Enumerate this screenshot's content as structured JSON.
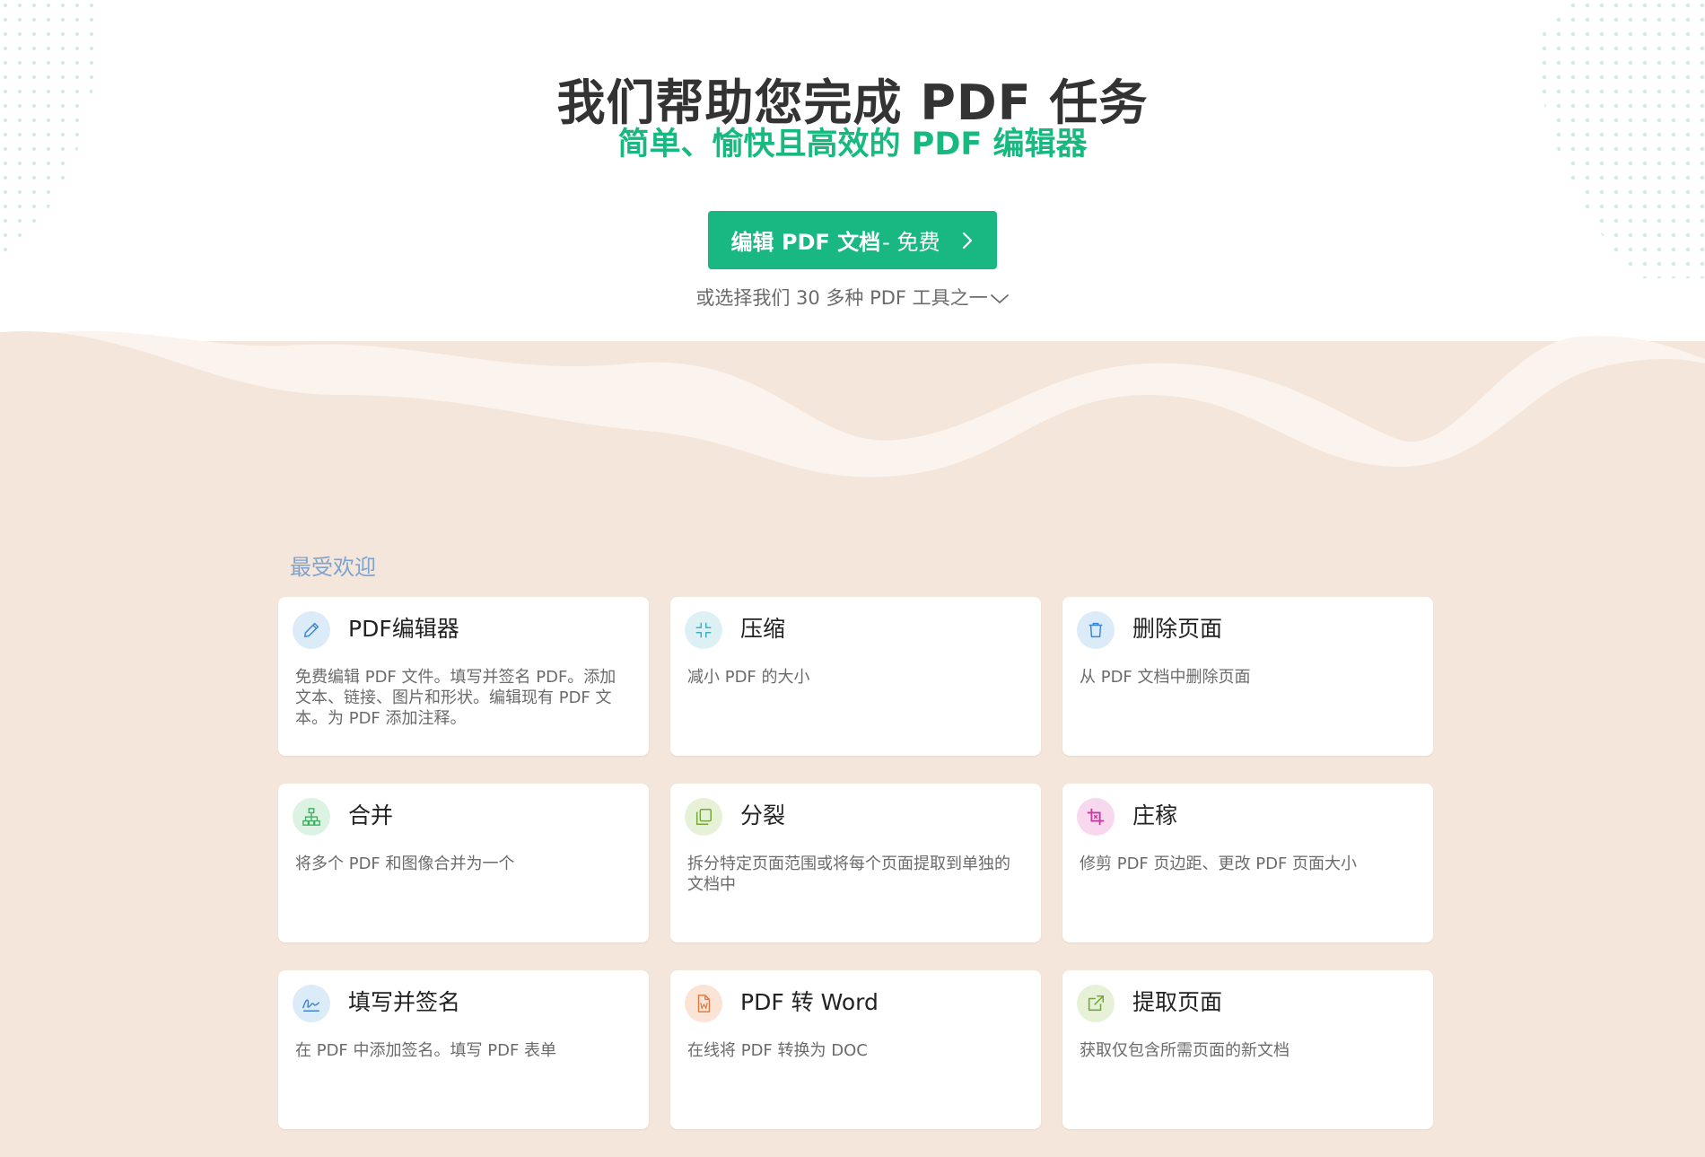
{
  "hero": {
    "title": "我们帮助您完成 PDF 任务",
    "subtitle": "简单、愉快且高效的 PDF 编辑器",
    "cta_main": "编辑 PDF 文档",
    "cta_free": "- 免费",
    "or_choose": "或选择我们 30 多种 PDF 工具之一"
  },
  "section": {
    "label": "最受欢迎"
  },
  "tools": [
    {
      "title": "PDF编辑器",
      "desc": "免费编辑 PDF 文件。填写并签名 PDF。添加文本、链接、图片和形状。编辑现有 PDF 文本。为 PDF 添加注释。",
      "icon": "pencil-icon",
      "icon_bg": "#dcebf8",
      "icon_color": "#3a86d4"
    },
    {
      "title": "压缩",
      "desc": "减小 PDF 的大小",
      "icon": "compress-icon",
      "icon_bg": "#ddf1f5",
      "icon_color": "#3ab0c8"
    },
    {
      "title": "删除页面",
      "desc": "从 PDF 文档中删除页面",
      "icon": "trash-icon",
      "icon_bg": "#dcebf8",
      "icon_color": "#3a86d4"
    },
    {
      "title": "合并",
      "desc": "将多个 PDF 和图像合并为一个",
      "icon": "sitemap-icon",
      "icon_bg": "#dcf3e3",
      "icon_color": "#3cae5f"
    },
    {
      "title": "分裂",
      "desc": "拆分特定页面范围或将每个页面提取到单独的文档中",
      "icon": "copy-icon",
      "icon_bg": "#e6f1d8",
      "icon_color": "#74a83a"
    },
    {
      "title": "庄稼",
      "desc": "修剪 PDF 页边距、更改 PDF 页面大小",
      "icon": "crop-icon",
      "icon_bg": "#f8d8ee",
      "icon_color": "#c83aa0"
    },
    {
      "title": "填写并签名",
      "desc": "在 PDF 中添加签名。填写 PDF 表单",
      "icon": "signature-icon",
      "icon_bg": "#dcebf8",
      "icon_color": "#3a86d4"
    },
    {
      "title": "PDF 转 Word",
      "desc": "在线将 PDF 转换为 DOC",
      "icon": "word-file-icon",
      "icon_bg": "#fbe3d6",
      "icon_color": "#e0773c"
    },
    {
      "title": "提取页面",
      "desc": "获取仅包含所需页面的新文档",
      "icon": "external-link-icon",
      "icon_bg": "#e6f1d8",
      "icon_color": "#74a83a"
    }
  ],
  "colors": {
    "accent": "#19b882",
    "subtitle": "#17b97e",
    "background": "#f4e6da",
    "section_label": "#7fa3cf"
  }
}
